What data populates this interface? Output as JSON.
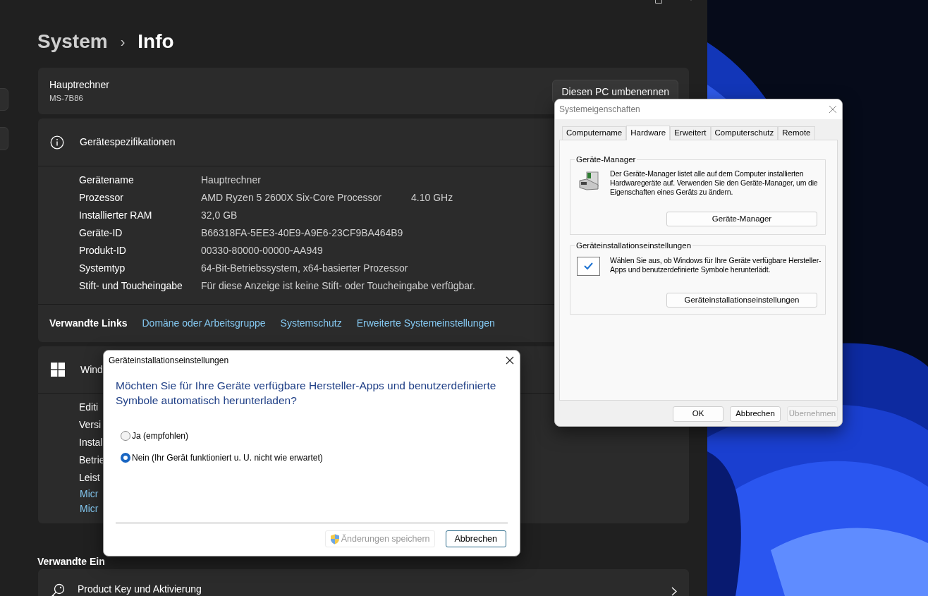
{
  "window": {
    "breadcrumb": [
      {
        "text": "System",
        "current": false
      },
      {
        "text": "Info",
        "current": true
      }
    ],
    "separator": "›"
  },
  "device_card": {
    "name": "Hauptrechner",
    "model": "MS-7B86",
    "rename_button": "Diesen PC umbenennen"
  },
  "specs": {
    "title": "Gerätespezifikationen",
    "rows": [
      {
        "label": "Gerätename",
        "value": "Hauptrechner"
      },
      {
        "label": "Prozessor",
        "value": "AMD Ryzen 5 2600X Six-Core Processor",
        "speed": "4.10 GHz"
      },
      {
        "label": "Installierter RAM",
        "value": "32,0 GB"
      },
      {
        "label": "Geräte-ID",
        "value": "B66318FA-5EE3-40E9-A9E6-23CF9BA464B9"
      },
      {
        "label": "Produkt-ID",
        "value": "00330-80000-00000-AA949"
      },
      {
        "label": "Systemtyp",
        "value": "64-Bit-Betriebssystem, x64-basierter Prozessor"
      },
      {
        "label": "Stift- und Toucheingabe",
        "value": "Für diese Anzeige ist keine Stift- oder Toucheingabe verfügbar."
      }
    ]
  },
  "related_links": {
    "label": "Verwandte Links",
    "links": [
      "Domäne oder Arbeitsgruppe",
      "Systemschutz",
      "Erweiterte Systemeinstellungen"
    ]
  },
  "windows_specs": {
    "title": "Wind",
    "rows": [
      {
        "label": "Editi",
        "kind": "text"
      },
      {
        "label": "Versi",
        "kind": "text"
      },
      {
        "label": "Instal",
        "kind": "text"
      },
      {
        "label": "Betrie",
        "kind": "text"
      },
      {
        "label": "Leist",
        "kind": "text"
      },
      {
        "label": "Micr",
        "kind": "link"
      },
      {
        "label": "Micr",
        "kind": "link"
      }
    ]
  },
  "related_settings": {
    "heading": "Verwandte Ein",
    "items": [
      {
        "title": "Product Key und Aktivierung"
      }
    ]
  },
  "system_properties": {
    "title": "Systemeigenschaften",
    "tabs": [
      {
        "label": "Computername",
        "selected": false
      },
      {
        "label": "Hardware",
        "selected": true
      },
      {
        "label": "Erweitert",
        "selected": false
      },
      {
        "label": "Computerschutz",
        "selected": false
      },
      {
        "label": "Remote",
        "selected": false
      }
    ],
    "groups": [
      {
        "kind": "device_manager",
        "legend": "Geräte-Manager",
        "description": "Der Geräte-Manager listet alle auf dem Computer installierten Hardwaregeräte auf. Verwenden Sie den Geräte-Manager, um die Eigenschaften eines Geräts zu ändern.",
        "button": "Geräte-Manager"
      },
      {
        "kind": "install_settings",
        "legend": "Geräteinstallationseinstellungen",
        "description": "Wählen Sie aus, ob Windows für Ihre Geräte verfügbare Hersteller-Apps und benutzerdefinierte Symbole herunterlädt.",
        "button": "Geräteinstallationseinstellungen"
      }
    ],
    "buttons": [
      {
        "label": "OK",
        "disabled": false
      },
      {
        "label": "Abbrechen",
        "disabled": false
      },
      {
        "label": "Übernehmen",
        "disabled": true
      }
    ]
  },
  "install_dialog": {
    "title": "Geräteinstallationseinstellungen",
    "question": "Möchten Sie für Ihre Geräte verfügbare Hersteller-Apps und benutzerdefinierte Symbole automatisch herunterladen?",
    "options": [
      {
        "label": "Ja (empfohlen)",
        "selected": false
      },
      {
        "label": "Nein (Ihr Gerät funktioniert u. U. nicht wie erwartet)",
        "selected": true
      }
    ],
    "buttons": [
      {
        "label": "Änderungen speichern",
        "disabled": true,
        "shield": true,
        "default": false
      },
      {
        "label": "Abbrechen",
        "disabled": false,
        "shield": false,
        "default": true
      }
    ]
  }
}
